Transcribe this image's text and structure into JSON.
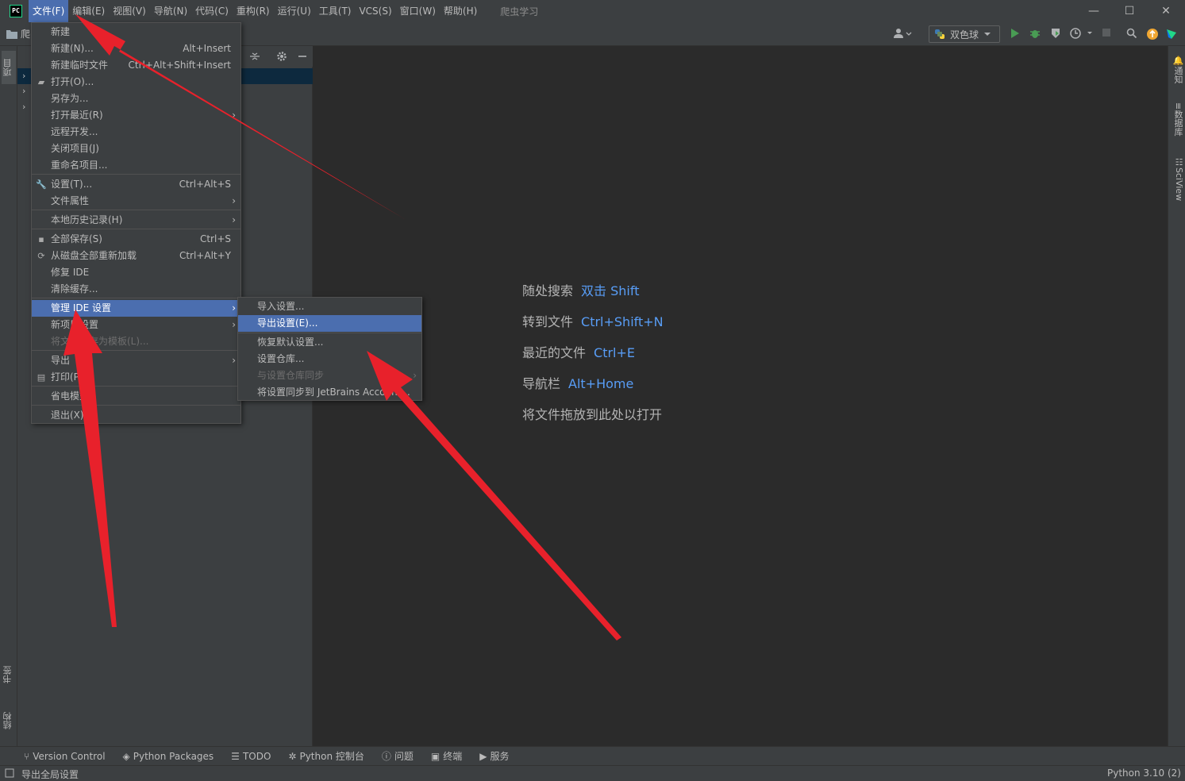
{
  "menubar": {
    "logo": "PC",
    "items": [
      "文件(F)",
      "编辑(E)",
      "视图(V)",
      "导航(N)",
      "代码(C)",
      "重构(R)",
      "运行(U)",
      "工具(T)",
      "VCS(S)",
      "窗口(W)",
      "帮助(H)"
    ],
    "project_title": "爬虫学习",
    "window_controls": {
      "minimize": "—",
      "maximize": "☐",
      "close": "✕"
    }
  },
  "toolbar": {
    "breadcrumb": "爬",
    "run_config": "双色球"
  },
  "left_strip": {
    "project_tab": "项目",
    "bookmarks_tab": "书签",
    "structure_tab": "结构"
  },
  "right_strip": {
    "notifications_tab": "通知",
    "database_tab": "数据库",
    "sciview_tab": "SciView"
  },
  "file_menu": {
    "items": [
      {
        "label": "新建",
        "shortcut": "",
        "icon": "",
        "submenu": false
      },
      {
        "label": "新建(N)...",
        "shortcut": "Alt+Insert",
        "icon": "",
        "submenu": false
      },
      {
        "label": "新建临时文件",
        "shortcut": "Ctrl+Alt+Shift+Insert",
        "icon": "",
        "submenu": false
      },
      {
        "label": "打开(O)...",
        "shortcut": "",
        "icon": "folder-icon",
        "submenu": false
      },
      {
        "label": "另存为...",
        "shortcut": "",
        "icon": "",
        "submenu": false
      },
      {
        "label": "打开最近(R)",
        "shortcut": "",
        "icon": "",
        "submenu": true
      },
      {
        "label": "远程开发...",
        "shortcut": "",
        "icon": "",
        "submenu": false
      },
      {
        "label": "关闭项目(J)",
        "shortcut": "",
        "icon": "",
        "submenu": false
      },
      {
        "label": "重命名项目...",
        "shortcut": "",
        "icon": "",
        "submenu": false
      },
      {
        "label": "设置(T)...",
        "shortcut": "Ctrl+Alt+S",
        "icon": "wrench-icon",
        "submenu": false
      },
      {
        "label": "文件属性",
        "shortcut": "",
        "icon": "",
        "submenu": true
      },
      {
        "label": "本地历史记录(H)",
        "shortcut": "",
        "icon": "",
        "submenu": true
      },
      {
        "label": "全部保存(S)",
        "shortcut": "Ctrl+S",
        "icon": "save-icon",
        "submenu": false
      },
      {
        "label": "从磁盘全部重新加载",
        "shortcut": "Ctrl+Alt+Y",
        "icon": "reload-icon",
        "submenu": false
      },
      {
        "label": "修复 IDE",
        "shortcut": "",
        "icon": "",
        "submenu": false
      },
      {
        "label": "清除缓存...",
        "shortcut": "",
        "icon": "",
        "submenu": false
      },
      {
        "label": "管理 IDE 设置",
        "shortcut": "",
        "icon": "",
        "submenu": true
      },
      {
        "label": "新项目设置",
        "shortcut": "",
        "icon": "",
        "submenu": true
      },
      {
        "label": "将文件另存为模板(L)...",
        "shortcut": "",
        "icon": "",
        "submenu": false
      },
      {
        "label": "导出",
        "shortcut": "",
        "icon": "",
        "submenu": true
      },
      {
        "label": "打印(P)...",
        "shortcut": "",
        "icon": "print-icon",
        "submenu": false
      },
      {
        "label": "省电模式",
        "shortcut": "",
        "icon": "",
        "submenu": false
      },
      {
        "label": "退出(X)",
        "shortcut": "",
        "icon": "",
        "submenu": false
      }
    ]
  },
  "sub_menu": {
    "items": [
      {
        "label": "导入设置..."
      },
      {
        "label": "导出设置(E)..."
      },
      {
        "label": "恢复默认设置..."
      },
      {
        "label": "设置仓库..."
      },
      {
        "label": "与设置仓库同步"
      },
      {
        "label": "将设置同步到 JetBrains Account..."
      }
    ]
  },
  "editor_hints": [
    {
      "label": "随处搜索",
      "key": "双击 Shift"
    },
    {
      "label": "转到文件",
      "key": "Ctrl+Shift+N"
    },
    {
      "label": "最近的文件",
      "key": "Ctrl+E"
    },
    {
      "label": "导航栏",
      "key": "Alt+Home"
    },
    {
      "label": "将文件拖放到此处以打开",
      "key": ""
    }
  ],
  "bottom_tabs": [
    "Version Control",
    "Python Packages",
    "TODO",
    "Python 控制台",
    "问题",
    "终端",
    "服务"
  ],
  "status_bar": {
    "message": "导出全局设置",
    "interpreter": "Python 3.10 (2)"
  },
  "colors": {
    "accent": "#4b6eaf",
    "arrow": "#e8212b",
    "hint_key": "#589df6",
    "panel": "#3c3f41",
    "editor": "#2b2b2b"
  }
}
